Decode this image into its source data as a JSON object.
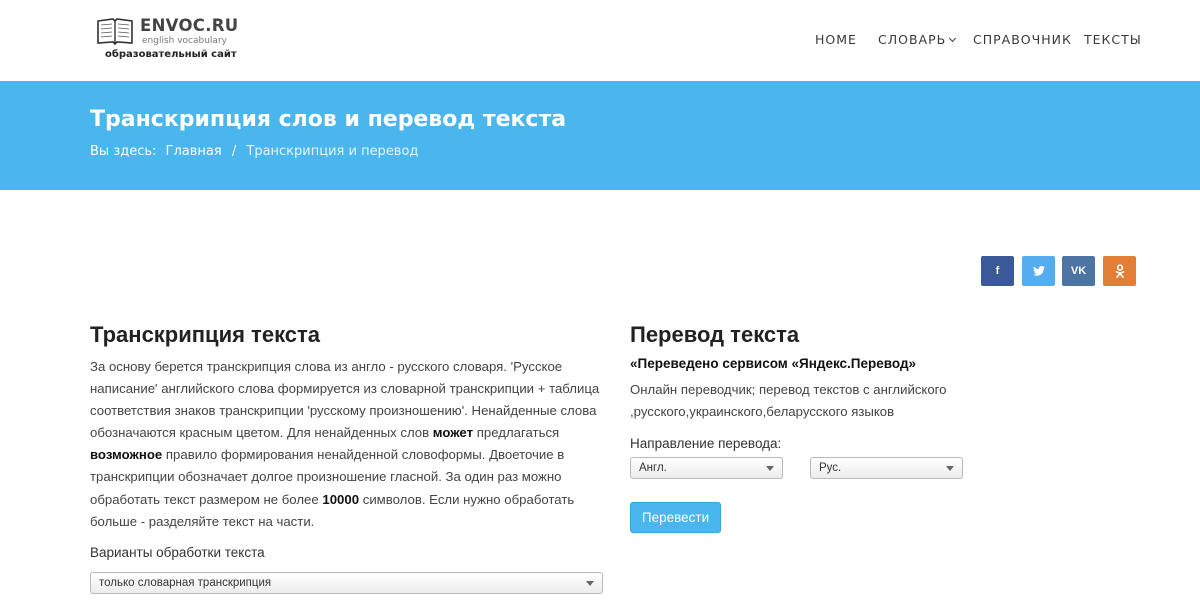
{
  "header": {
    "logo_name": "ENVOC.RU",
    "logo_sub": "english vocabulary",
    "logo_caption": "образовательный сайт",
    "nav": [
      {
        "label": "HOME"
      },
      {
        "label": "СЛОВАРЬ",
        "has_dropdown": true
      },
      {
        "label": "СПРАВОЧНИК"
      },
      {
        "label": "ТЕКСТЫ"
      }
    ]
  },
  "banner": {
    "title": "Транскрипция слов и перевод текста",
    "breadcrumb_prefix": "Вы здесь:",
    "breadcrumb_home": "Главная",
    "breadcrumb_separator": "/",
    "breadcrumb_current": "Транскрипция и перевод",
    "background_color": "#4ab6ee"
  },
  "social": [
    {
      "icon": "facebook-icon",
      "glyph": "f",
      "color": "#3b5998"
    },
    {
      "icon": "twitter-icon",
      "glyph": "t",
      "color": "#55acee"
    },
    {
      "icon": "vk-icon",
      "glyph": "VK",
      "color": "#4c75a3"
    },
    {
      "icon": "odnoklassniki-icon",
      "glyph": "ok",
      "color": "#e27e35"
    }
  ],
  "transcription": {
    "title": "Транскрипция текста",
    "desc_1": "За основу берется транскрипция слова из англо - русского словаря. 'Русское написание' английского слова формируется из словарной транскрипции + таблица соответствия знаков транскрипции 'русскому произношению'. Ненайденные слова обозначаются красным цветом. Для ненайденных слов ",
    "desc_bold_1": "может",
    "desc_2": " предлагаться ",
    "desc_bold_2": "возможное",
    "desc_3": " правило формирования ненайденной словоформы. Двоеточие в транскрипции обозначает долгое произношение гласной. За один раз можно обработать текст размером не более ",
    "desc_bold_3": "10000",
    "desc_4": " символов. Если нужно обработать больше - разделяйте текст на части.",
    "options_label": "Варианты обработки текста",
    "options_selected": "только словарная транскрипция"
  },
  "translation": {
    "title": "Перевод текста",
    "service_note": "«Переведено сервисом «Яндекс.Перевод»",
    "description": "Онлайн переводчик; перевод текстов с английского ,русского,украинского,беларусского языков",
    "direction_label": "Направление перевода:",
    "from_language": "Англ.",
    "to_language": "Рус.",
    "translate_button": "Перевести",
    "button_color": "#4ab6ee"
  }
}
